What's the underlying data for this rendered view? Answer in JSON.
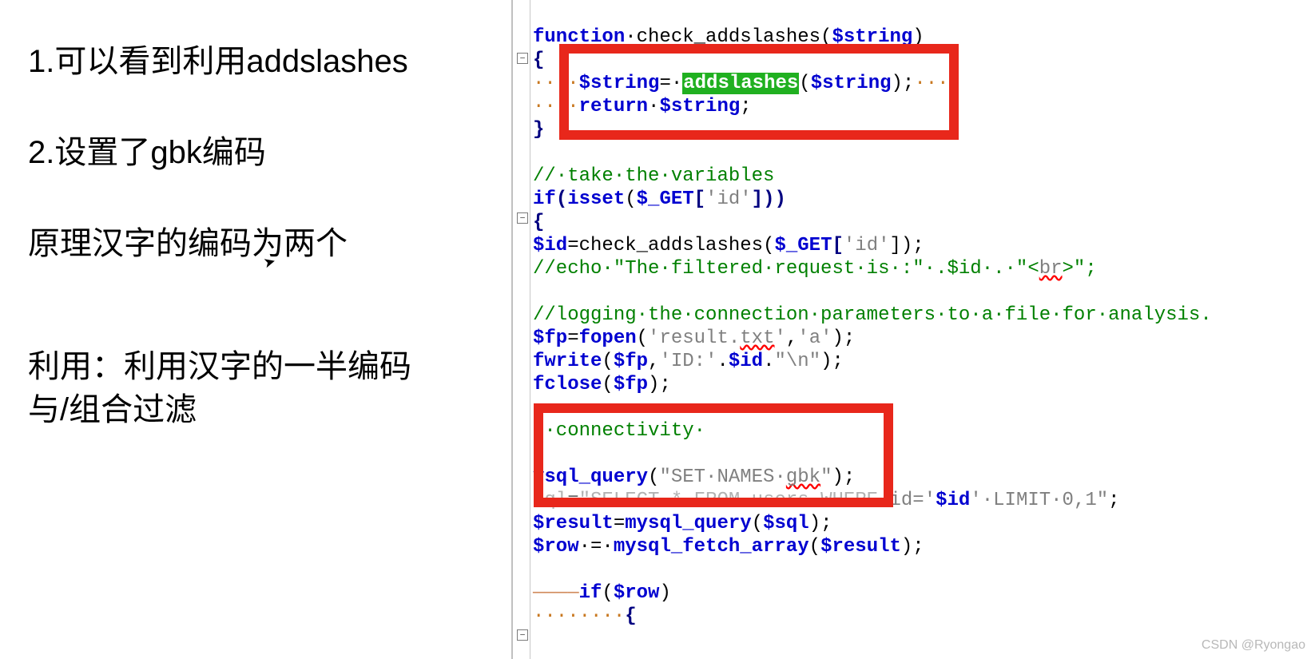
{
  "left": {
    "h1": "1.可以看到利用addslashes",
    "h2": "2.设置了gbk编码",
    "p1": "原理汉字的编码为两个",
    "p2a": "利用：利用汉字的一半编码",
    "p2b": "与/组合过滤"
  },
  "folds": {
    "f1": "−",
    "f2": "−",
    "f3": "−"
  },
  "code": {
    "l1_a": "function",
    "l1_b": "·check_addslashes(",
    "l1_c": "$string",
    "l1_d": ")",
    "l2": "{",
    "l3_ind": "····",
    "l3_a": "$string",
    "l3_b": "=·",
    "l3_c": "addslashes",
    "l3_d": "(",
    "l3_e": "$string",
    "l3_f": ");",
    "l3_tail": "···",
    "l4_ind": "····",
    "l4_a": "return",
    "l4_b": "·",
    "l4_c": "$string",
    "l4_d": ";",
    "l5": "}",
    "l7": "//·take·the·variables",
    "l8_a": "if",
    "l8_b": "(",
    "l8_c": "isset",
    "l8_d": "(",
    "l8_e": "$_GET",
    "l8_f": "[",
    "l8_g": "'id'",
    "l8_h": "]))",
    "l9": "{",
    "l10_a": "$id",
    "l10_b": "=check_addslashes(",
    "l10_c": "$_GET",
    "l10_d": "[",
    "l10_e": "'id'",
    "l10_f": "]);",
    "l11_a": "//echo·\"The·filtered·request·is·:\"·.",
    "l11_b": "$id",
    "l11_c": "·.·\"<",
    "l11_d": "br",
    "l11_e": ">\";",
    "l13": "//logging·the·connection·parameters·to·a·file·for·analysis.",
    "l14_a": "$fp",
    "l14_b": "=",
    "l14_c": "fopen",
    "l14_d": "(",
    "l14_e": "'result.",
    "l14_f": "txt",
    "l14_g": "'",
    "l14_h": ",",
    "l14_i": "'a'",
    "l14_j": ");",
    "l15_a": "fwrite",
    "l15_b": "(",
    "l15_c": "$fp",
    "l15_d": ",",
    "l15_e": "'ID:'",
    "l15_f": ".",
    "l15_g": "$id",
    "l15_h": ".",
    "l15_i": "\"\\n\"",
    "l15_j": ");",
    "l16_a": "fclose",
    "l16_b": "(",
    "l16_c": "$fp",
    "l16_d": ");",
    "l18_a": "/·connectivity·",
    "l20_a": "ysql_query",
    "l20_b": "(",
    "l20_c": "\"SET·NAMES·",
    "l20_d": "gbk",
    "l20_e": "\"",
    "l20_f": ");",
    "l21_a": "sql",
    "l21_b": "=",
    "l21_c": "\"SELECT·*·FROM·users·WHERE·",
    "l21_d": "id='",
    "l21_e": "$id",
    "l21_f": "'·LIMIT·0,1\"",
    "l21_g": ";",
    "l22_a": "$result",
    "l22_b": "=",
    "l22_c": "mysql_query",
    "l22_d": "(",
    "l22_e": "$sql",
    "l22_f": ");",
    "l23_a": "$row",
    "l23_b": "·=·",
    "l23_c": "mysql_fetch_array",
    "l23_d": "(",
    "l23_e": "$result",
    "l23_f": ");",
    "l25_ind": "————",
    "l25_a": "if",
    "l25_b": "(",
    "l25_c": "$row",
    "l25_d": ")",
    "l26_ind": "········",
    "l26_a": "{"
  },
  "watermark": "CSDN @Ryongao"
}
